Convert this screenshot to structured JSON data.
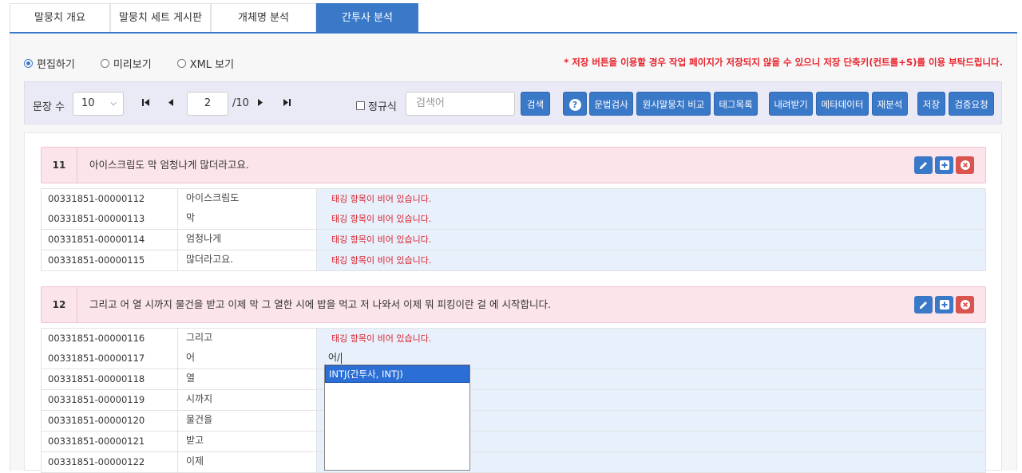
{
  "tabs": [
    {
      "label": "말뭉치 개요"
    },
    {
      "label": "말뭉치 세트 게시판"
    },
    {
      "label": "개체명 분석"
    },
    {
      "label": "간투사 분석"
    }
  ],
  "mode": {
    "options": [
      {
        "label": "편집하기",
        "selected": true
      },
      {
        "label": "미리보기",
        "selected": false
      },
      {
        "label": "XML 보기",
        "selected": false
      }
    ],
    "notice": "* 저장 버튼을 이용할 경우 작업 페이지가 저장되지 않을 수 있으니 저장 단축키(컨트롤+S)를 이용 부탁드립니다."
  },
  "toolbar": {
    "sentence_count_label": "문장 수",
    "sentence_count_value": "10",
    "page_current": "2",
    "page_total": "/10",
    "regex_label": "정규식",
    "search_placeholder": "검색어",
    "search_button": "검색",
    "help_glyph": "?",
    "buttons": [
      "문법검사",
      "원시말뭉치 비교",
      "태그목록",
      "내려받기",
      "메타데이터",
      "재분석",
      "저장",
      "검증요청"
    ]
  },
  "sentences": [
    {
      "num": "11",
      "text": "아이스크림도 막 엄청나게 많더라고요.",
      "rows": [
        {
          "id": "00331851-00000112",
          "word": "아이스크림도",
          "tag": "태깅 항목이 비어 있습니다."
        },
        {
          "id": "00331851-00000113",
          "word": "막",
          "tag": "태깅 항목이 비어 있습니다."
        },
        {
          "id": "00331851-00000114",
          "word": "엄청나게",
          "tag": "태깅 항목이 비어 있습니다."
        },
        {
          "id": "00331851-00000115",
          "word": "많더라고요.",
          "tag": "태깅 항목이 비어 있습니다."
        }
      ]
    },
    {
      "num": "12",
      "text": "그리고 어 열 시까지 물건을 받고 이제 막 그 열한 시에 밥을 먹고 저 나와서 이제 뭐 피킹이란 걸 에 시작합니다.",
      "rows": [
        {
          "id": "00331851-00000116",
          "word": "그리고",
          "tag": "태깅 항목이 비어 있습니다."
        },
        {
          "id": "00331851-00000117",
          "word": "어",
          "tag": "어/"
        },
        {
          "id": "00331851-00000118",
          "word": "열",
          "tag": ""
        },
        {
          "id": "00331851-00000119",
          "word": "시까지",
          "tag": ""
        },
        {
          "id": "00331851-00000120",
          "word": "물건을",
          "tag": ""
        },
        {
          "id": "00331851-00000121",
          "word": "받고",
          "tag": ""
        },
        {
          "id": "00331851-00000122",
          "word": "이제",
          "tag": ""
        }
      ]
    }
  ],
  "autocomplete": {
    "options": [
      "INTJ(간투사, INTJ)"
    ]
  },
  "colors": {
    "accent": "#3a78c8",
    "notice": "#e8232d",
    "sentence_bg": "#fbe4ea",
    "tag_bg": "#e8f0fb",
    "delete": "#d9534f"
  }
}
